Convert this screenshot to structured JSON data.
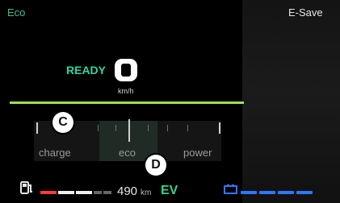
{
  "header": {
    "mode_label": "Eco",
    "esave_label": "E-Save"
  },
  "status": {
    "ready_label": "READY",
    "speed_unit": "km/h"
  },
  "gauge": {
    "labels": [
      "charge",
      "eco",
      "power"
    ]
  },
  "annotations": {
    "badge_c": "C",
    "badge_d": "D"
  },
  "footer": {
    "range_value": "490",
    "range_unit": "km",
    "drive_mode": "EV"
  },
  "colors": {
    "mode_text": "#3fbf8f",
    "ready_text": "#2fd6a1",
    "separator_line": "#9fe04d",
    "ev_text": "#33d48a",
    "battery_blue": "#2c78ff",
    "fuel_red": "#ff3b3b"
  },
  "icons": {
    "fuel": "fuel-pump-icon",
    "battery": "battery-icon"
  }
}
